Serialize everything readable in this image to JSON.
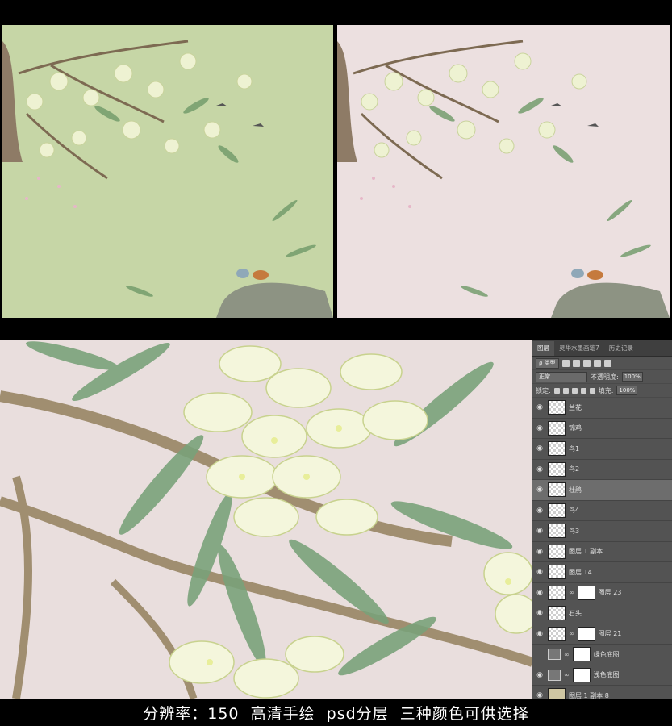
{
  "colors": {
    "green_bg": "#c6d6a6",
    "pink_bg": "#ece0e0",
    "detail_bg": "#e9dedd",
    "panel_bg": "#535353"
  },
  "panel": {
    "tabs": [
      "图层",
      "灵华水墨画笔7",
      "历史记录"
    ],
    "filter_label": "ρ 类型",
    "blend_mode": "正常",
    "opacity_label": "不透明度:",
    "opacity_value": "100%",
    "lock_label": "锁定:",
    "fill_label": "填充:",
    "fill_value": "100%",
    "layers": [
      {
        "name": "兰花",
        "visible": true,
        "thumb": "transparent"
      },
      {
        "name": "锦鸡",
        "visible": true,
        "thumb": "transparent"
      },
      {
        "name": "鸟1",
        "visible": true,
        "thumb": "transparent"
      },
      {
        "name": "鸟2",
        "visible": true,
        "thumb": "transparent"
      },
      {
        "name": "杜鹃",
        "visible": true,
        "thumb": "transparent",
        "selected": true
      },
      {
        "name": "鸟4",
        "visible": true,
        "thumb": "transparent"
      },
      {
        "name": "鸟3",
        "visible": true,
        "thumb": "transparent"
      },
      {
        "name": "图层 1 副本",
        "visible": true,
        "thumb": "transparent"
      },
      {
        "name": "图层 14",
        "visible": true,
        "thumb": "transparent"
      },
      {
        "name": "图层 23",
        "visible": true,
        "thumb": "transparent",
        "mask": true
      },
      {
        "name": "石头",
        "visible": true,
        "thumb": "transparent"
      },
      {
        "name": "图层 21",
        "visible": true,
        "thumb": "transparent",
        "mask": true
      },
      {
        "name": "绿色底图",
        "visible": false,
        "thumb": "adjustment",
        "mask": true
      },
      {
        "name": "浅色底图",
        "visible": true,
        "thumb": "adjustment",
        "mask": true
      },
      {
        "name": "图层 1 副本 8",
        "visible": true,
        "thumb": "beige"
      }
    ]
  },
  "caption": "分辨率：150  高清手绘  psd分层  三种颜色可供选择"
}
